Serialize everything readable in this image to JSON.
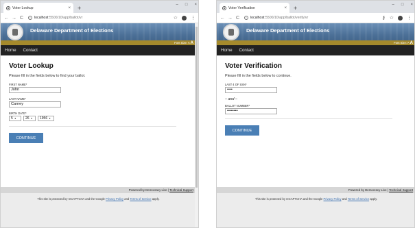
{
  "left": {
    "tab_title": "Voter Lookup",
    "url_host": "localhost",
    "url_path": ":5500/10/app/ballot/vr",
    "dept_title": "Delaware Department of Elections",
    "font_size_label": "Font Size: A",
    "font_size_big": "A",
    "nav": {
      "home": "Home",
      "contact": "Contact"
    },
    "heading": "Voter Lookup",
    "intro": "Please fill in the fields below to find your ballot.",
    "first_name_label": "FIRST NAME*",
    "first_name_value": "John",
    "last_name_label": "LAST NAME*",
    "last_name_value": "Carney",
    "birth_date_label": "BIRTH DATE*",
    "birth_month": "5",
    "birth_day": "26",
    "birth_year": "1956",
    "continue_label": "CONTINUE",
    "footer_text": "Powered by Democracy Live | ",
    "footer_link": "Technical Support",
    "captcha_prefix": "This site is protected by reCAPTCHA and the Google ",
    "privacy_link": "Privacy Policy",
    "captcha_and": " and ",
    "terms_link": "Terms of Service",
    "captcha_suffix": " apply."
  },
  "right": {
    "tab_title": "Voter Verification",
    "url_host": "localhost",
    "url_path": ":5500/10/app/ballot/verify/vr",
    "dept_title": "Delaware Department of Elections",
    "font_size_label": "Font Size: A",
    "font_size_big": "A",
    "nav": {
      "home": "Home",
      "contact": "Contact"
    },
    "heading": "Voter Verification",
    "intro": "Please fill in the fields below to continue.",
    "ssn_label": "LAST 4 OF SSN*",
    "ssn_value": "••••",
    "and_or": "– and –",
    "ballot_label": "BALLOT NUMBER*",
    "ballot_value": "••••••••",
    "continue_label": "CONTINUE",
    "footer_text": "Powered by Democracy Live | ",
    "footer_link": "Technical Support",
    "captcha_prefix": "This site is protected by reCAPTCHA and the Google ",
    "privacy_link": "Privacy Policy",
    "captcha_and": " and ",
    "terms_link": "Terms of Service",
    "captcha_suffix": " apply."
  },
  "browser": {
    "back": "←",
    "forward": "→",
    "reload": "C",
    "new_tab": "+",
    "close_tab": "×",
    "minimize": "–",
    "maximize": "□",
    "close_window": "×",
    "star": "☆",
    "menu": "⋮",
    "key": "⚷",
    "select_arrow": "▼"
  }
}
